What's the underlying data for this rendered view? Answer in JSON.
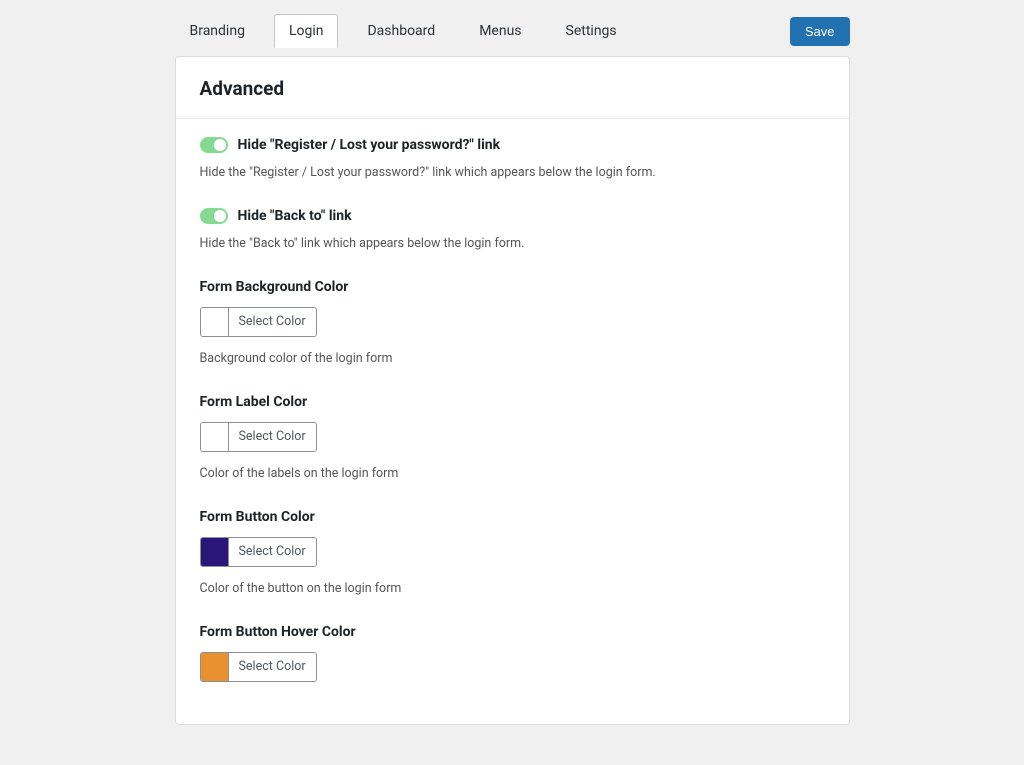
{
  "tabs": {
    "items": [
      {
        "label": "Branding",
        "active": false
      },
      {
        "label": "Login",
        "active": true
      },
      {
        "label": "Dashboard",
        "active": false
      },
      {
        "label": "Menus",
        "active": false
      },
      {
        "label": "Settings",
        "active": false
      }
    ]
  },
  "save_button": "Save",
  "panel_title": "Advanced",
  "select_color_label": "Select Color",
  "settings": {
    "hide_register": {
      "title": "Hide \"Register / Lost your password?\" link",
      "desc": "Hide the \"Register / Lost your password?\" link which appears below the login form.",
      "enabled": true
    },
    "hide_back_to": {
      "title": "Hide \"Back to\" link",
      "desc": "Hide the \"Back to\" link which appears below the login form.",
      "enabled": true
    },
    "form_bg_color": {
      "title": "Form Background Color",
      "desc": "Background color of the login form",
      "color": "#ffffff"
    },
    "form_label_color": {
      "title": "Form Label Color",
      "desc": "Color of the labels on the login form",
      "color": "#ffffff"
    },
    "form_button_color": {
      "title": "Form Button Color",
      "desc": "Color of the button on the login form",
      "color": "#2a1678"
    },
    "form_button_hover_color": {
      "title": "Form Button Hover Color",
      "desc": "",
      "color": "#e9902f"
    }
  }
}
